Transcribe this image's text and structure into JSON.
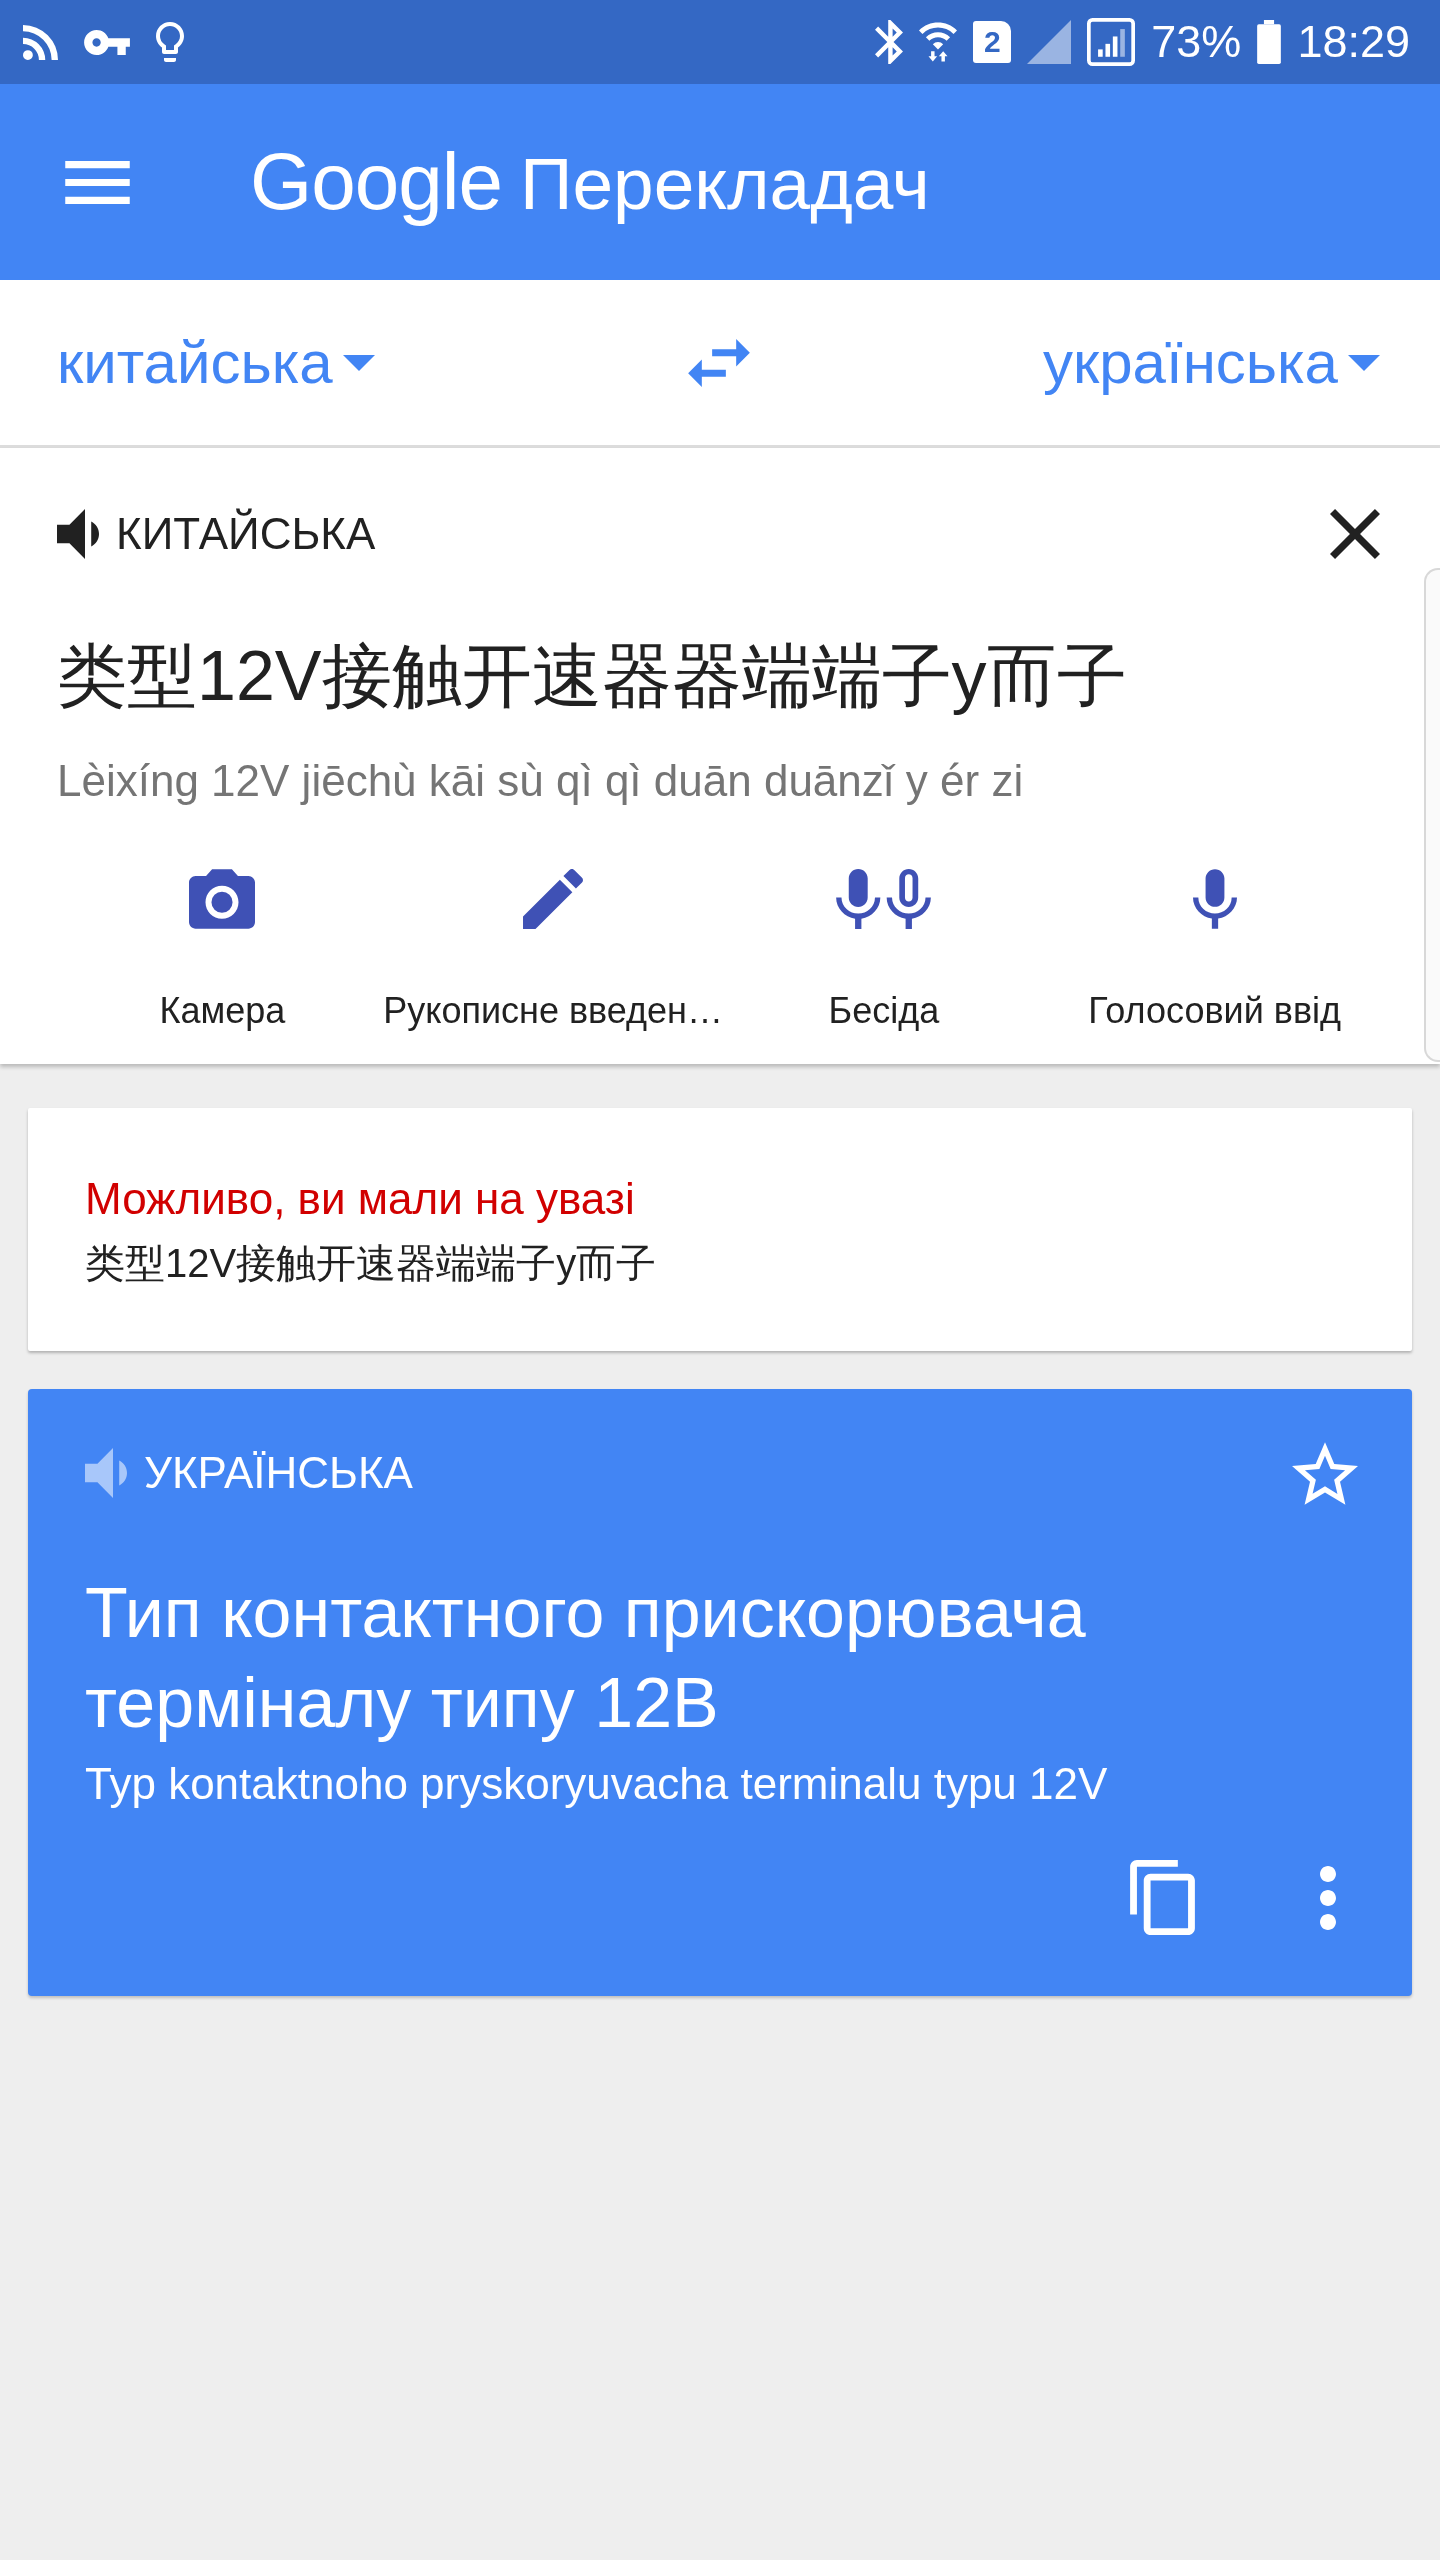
{
  "status_bar": {
    "sim_slot": "2",
    "battery": "73%",
    "time": "18:29"
  },
  "app_bar": {
    "logo": "Google",
    "title": "Перекладач"
  },
  "language_bar": {
    "source": "китайська",
    "target": "українська"
  },
  "input_card": {
    "language": "КИТАЙСЬКА",
    "text": "类型12V接触开速器器端端子y而子",
    "transliteration": "Lèixíng 12V jiēchù kāi sù qì qì duān duānzǐ y ér zi",
    "tools": [
      {
        "kind": "camera",
        "label": "Камера"
      },
      {
        "kind": "handwriting",
        "label": "Рукописне введен…"
      },
      {
        "kind": "conversation",
        "label": "Бесіда"
      },
      {
        "kind": "voice",
        "label": "Голосовий ввід"
      }
    ]
  },
  "suggestion_card": {
    "heading": "Можливо, ви мали на увазі",
    "text": "类型12V接触开速器端端子y而子"
  },
  "result_card": {
    "language": "УКРАЇНСЬКА",
    "starred": false,
    "text": "Тип контактного прискорювача терміналу типу 12В",
    "transliteration": "Typ kontaktnoho pryskoryuvacha terminalu typu 12V"
  }
}
